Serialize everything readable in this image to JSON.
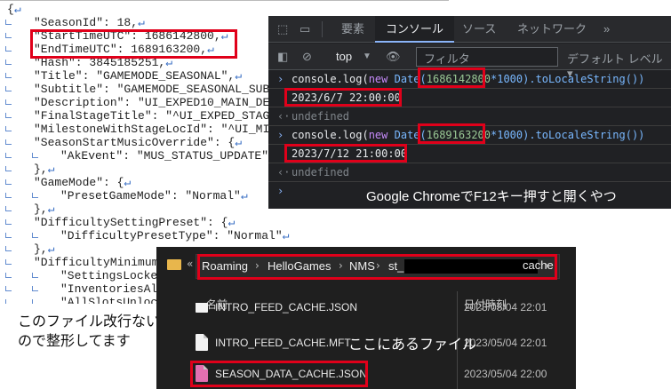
{
  "editor": {
    "lines": [
      {
        "indent": 0,
        "text": "{",
        "eol": "↵"
      },
      {
        "indent": 1,
        "text": "\"SeasonId\": 18,",
        "eol": "↵"
      },
      {
        "indent": 1,
        "text": "\"StartTimeUTC\": 1686142800,",
        "eol": "↵"
      },
      {
        "indent": 1,
        "text": "\"EndTimeUTC\": 1689163200,",
        "eol": "↵"
      },
      {
        "indent": 1,
        "text": "\"Hash\": 3845185251,",
        "eol": "↵"
      },
      {
        "indent": 1,
        "text": "\"Title\": \"GAMEMODE_SEASONAL\",",
        "eol": "↵"
      },
      {
        "indent": 1,
        "text": "\"Subtitle\": \"GAMEMODE_SEASONAL_SUBT",
        "eol": ""
      },
      {
        "indent": 1,
        "text": "\"Description\": \"UI_EXPED10_MAIN_DESC",
        "eol": ""
      },
      {
        "indent": 1,
        "text": "\"FinalStageTitle\": \"^UI_EXPED_STAGE_",
        "eol": ""
      },
      {
        "indent": 1,
        "text": "\"MilestoneWithStageLocId\": \"^UI_MILE",
        "eol": ""
      },
      {
        "indent": 1,
        "text": "\"SeasonStartMusicOverride\": {",
        "eol": "↵"
      },
      {
        "indent": 2,
        "text": "\"AkEvent\": \"MUS_STATUS_UPDATE\"",
        "eol": "↵"
      },
      {
        "indent": 1,
        "text": "},",
        "eol": "↵"
      },
      {
        "indent": 1,
        "text": "\"GameMode\": {",
        "eol": "↵"
      },
      {
        "indent": 2,
        "text": "\"PresetGameMode\": \"Normal\"",
        "eol": "↵"
      },
      {
        "indent": 1,
        "text": "},",
        "eol": "↵"
      },
      {
        "indent": 1,
        "text": "\"DifficultySettingPreset\": {",
        "eol": "↵"
      },
      {
        "indent": 2,
        "text": "\"DifficultyPresetType\": \"Normal\"",
        "eol": "↵"
      },
      {
        "indent": 1,
        "text": "},",
        "eol": "↵"
      },
      {
        "indent": 1,
        "text": "\"DifficultyMinimums",
        "eol": ""
      },
      {
        "indent": 2,
        "text": "\"SettingsLocked",
        "eol": ""
      },
      {
        "indent": 2,
        "text": "\"InventoriesAlw",
        "eol": ""
      },
      {
        "indent": 2,
        "text": "\"AllSlotsUnlock",
        "eol": ""
      }
    ]
  },
  "editor_caption": [
    "このファイル改行ない",
    "ので整形してます"
  ],
  "devtools": {
    "tabs": [
      "要素",
      "コンソール",
      "ソース",
      "ネットワーク",
      "»"
    ],
    "active_tab": "コンソール",
    "context": "top",
    "filter_placeholder": "フィルタ",
    "level": "デフォルト レベル ▾",
    "log1": {
      "pre": "console.log(",
      "kw": "new",
      "fn": " Date(",
      "num": "1686142800",
      "post": "*1000).toLocaleString())"
    },
    "out1": "2023/6/7 22:00:00",
    "undef1": "undefined",
    "log2": {
      "pre": "console.log(",
      "kw": "new",
      "fn": " Date(",
      "num": "1689163200",
      "post": "*1000).toLocaleString())"
    },
    "out2": "2023/7/12 21:00:00",
    "undef2": "undefined",
    "caption": "Google ChromeでF12キー押すと開くやつ"
  },
  "explorer": {
    "path": [
      "Roaming",
      "HelloGames",
      "NMS",
      "st_",
      "cache"
    ],
    "col_name": "名前",
    "col_date": "日付時刻",
    "files": [
      {
        "name": "INTRO_FEED_CACHE.JSON",
        "date": "2023/05/04 22:01"
      },
      {
        "name": "INTRO_FEED_CACHE.MFT",
        "date": "2023/05/04 22:01"
      },
      {
        "name": "SEASON_DATA_CACHE.JSON",
        "date": "2023/05/04 22:00"
      }
    ],
    "caption": "ここにあるファイル"
  }
}
